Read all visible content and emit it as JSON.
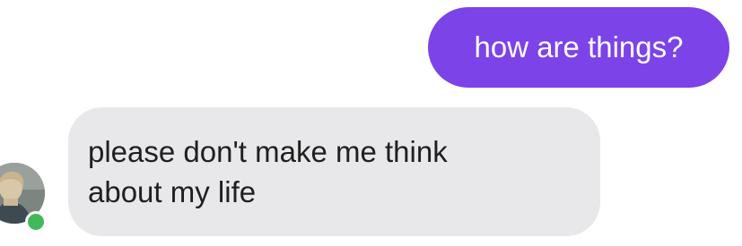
{
  "conversation": {
    "sent_message": {
      "text": "how are things?"
    },
    "received_message": {
      "lines": [
        "please don't make me think",
        "about my life"
      ]
    },
    "contact": {
      "avatar_icon": "profile-photo",
      "status": "online",
      "status_color": "#43b85a"
    }
  },
  "colors": {
    "sent_bubble": "#7b43e8",
    "received_bubble": "#e8e8eb",
    "background": "#ffffff"
  }
}
